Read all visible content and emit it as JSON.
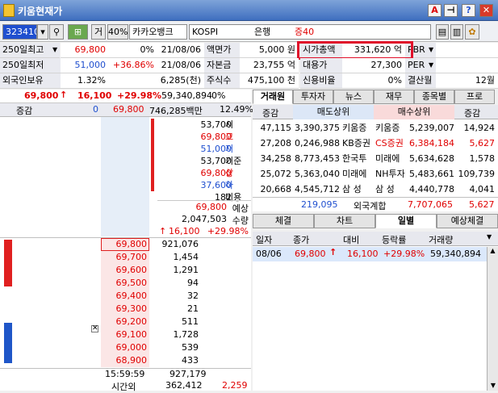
{
  "window": {
    "title": "키움현재가"
  },
  "toolbar": {
    "code": "323410",
    "order": "거",
    "margin": "40%",
    "name": "카카오뱅크",
    "market": "KOSPI",
    "sector": "은행",
    "group": "증40"
  },
  "info": {
    "rows": [
      {
        "l1": "250일최고",
        "v1": "69,800",
        "v2": "0%",
        "v3": "21/08/06",
        "l2": "액면가",
        "v4": "5,000 원",
        "l3": "시가총액",
        "v5": "331,620 억",
        "l4": "PBR"
      },
      {
        "l1": "250일최저",
        "v1": "51,000",
        "v2": "+36.86%",
        "v3": "21/08/06",
        "l2": "자본금",
        "v4": "23,755 억",
        "l3": "대용가",
        "v5": "27,300",
        "l4": "PER"
      },
      {
        "l1": "외국인보유",
        "v1": "1.32%",
        "v2": "",
        "v3": "6,285(천)",
        "l2": "주식수",
        "v4": "475,100 천",
        "l3": "신용비율",
        "v5": "0%",
        "l4": "결산월",
        "v6": "12월"
      }
    ]
  },
  "price": {
    "cur": "69,800",
    "arrow": "↑",
    "chg": "16,100",
    "pct": "+29.98%",
    "vol": "59,340,894",
    "volpct": "0%"
  },
  "ob_header": {
    "a": "증감",
    "b": "0",
    "c": "69,800",
    "d": "746,285백만",
    "e": "12.49%"
  },
  "summary": [
    {
      "v": "53,700",
      "k": "시"
    },
    {
      "v": "69,800",
      "k": "고"
    },
    {
      "v": "51,000",
      "k": "저"
    },
    {
      "v": "53,700",
      "k": "기준"
    },
    {
      "v": "69,800",
      "k": "상"
    },
    {
      "v": "37,600",
      "k": "하"
    },
    {
      "v": "182",
      "k": "비용"
    }
  ],
  "expect": {
    "price": "69,800",
    "plabel": "예상",
    "vol": "2,047,503",
    "vlabel": "수량",
    "chg": "16,100",
    "pct": "+29.98%"
  },
  "bids": [
    {
      "p": "69,800",
      "q": "921,076"
    },
    {
      "p": "69,700",
      "q": "1,454"
    },
    {
      "p": "69,600",
      "q": "1,291"
    },
    {
      "p": "69,500",
      "q": "94"
    },
    {
      "p": "69,400",
      "q": "32"
    },
    {
      "p": "69,300",
      "q": "21"
    },
    {
      "p": "69,200",
      "q": "511"
    },
    {
      "p": "69,100",
      "q": "1,728"
    },
    {
      "p": "69,000",
      "q": "539"
    },
    {
      "p": "68,900",
      "q": "433"
    }
  ],
  "footer": {
    "time": "15:59:59",
    "total": "927,179",
    "after": "시간외",
    "after_q": "362,412",
    "after_r": "2,259"
  },
  "tabs_top": [
    "거래원",
    "투자자",
    "뉴스",
    "재무",
    "종목별",
    "프로"
  ],
  "broker": {
    "h1": "증감",
    "h2": "매도상위",
    "h3": "매수상위",
    "h4": "증감",
    "rows": [
      {
        "a": "47,115",
        "b": "3,390,375",
        "c": "키움증",
        "d": "키움증",
        "e": "5,239,007",
        "f": "14,924"
      },
      {
        "a": "27,208",
        "b": "0,246,988",
        "c": "KB증권",
        "d": "CS증권",
        "e": "6,384,184",
        "f": "5,627"
      },
      {
        "a": "34,258",
        "b": "8,773,453",
        "c": "한국투",
        "d": "미래에",
        "e": "5,634,628",
        "f": "1,578"
      },
      {
        "a": "25,072",
        "b": "5,363,040",
        "c": "미래에",
        "d": "NH투자",
        "e": "5,483,661",
        "f": "109,739"
      },
      {
        "a": "20,668",
        "b": "4,545,712",
        "c": "삼 성",
        "d": "삼 성",
        "e": "4,440,778",
        "f": "4,041"
      }
    ],
    "foreign": {
      "a": "219,095",
      "label": "외국계합",
      "b": "7,707,065",
      "c": "5,627"
    }
  },
  "tabs_bot": [
    "체결",
    "차트",
    "일별",
    "예상체결"
  ],
  "daily": {
    "headers": [
      "일자",
      "종가",
      "대비",
      "등락률",
      "거래량"
    ],
    "rows": [
      {
        "date": "08/06",
        "close": "69,800",
        "arrow": "↑",
        "diff": "16,100",
        "rate": "+29.98%",
        "vol": "59,340,894"
      }
    ]
  }
}
